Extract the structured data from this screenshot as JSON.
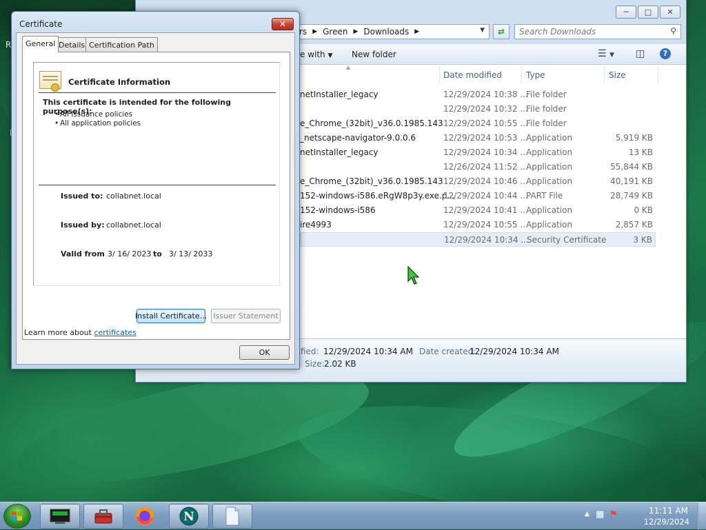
{
  "explorer": {
    "address": {
      "crumbs": [
        "rs",
        "Green",
        "Downloads"
      ]
    },
    "search_placeholder": "Search Downloads",
    "toolbar": {
      "open_with": "e with",
      "new_folder": "New folder"
    },
    "columns": {
      "date_modified": "Date modified",
      "type": "Type",
      "size": "Size"
    },
    "rows": [
      {
        "name": "netInstaller_legacy",
        "date": "12/29/2024 10:38 ...",
        "type": "File folder",
        "size": ""
      },
      {
        "name": "",
        "date": "12/29/2024 10:32 ...",
        "type": "File folder",
        "size": ""
      },
      {
        "name": "e_Chrome_(32bit)_v36.0.1985.143",
        "date": "12/29/2024 10:55 ...",
        "type": "File folder",
        "size": ""
      },
      {
        "name": "_netscape-navigator-9.0.0.6",
        "date": "12/29/2024 10:53 ...",
        "type": "Application",
        "size": "5,919 KB"
      },
      {
        "name": "netInstaller_legacy",
        "date": "12/29/2024 10:34 ...",
        "type": "Application",
        "size": "13 KB"
      },
      {
        "name": "",
        "date": "12/26/2024 11:52 ...",
        "type": "Application",
        "size": "55,844 KB"
      },
      {
        "name": "e_Chrome_(32bit)_v36.0.1985.143",
        "date": "12/29/2024 10:46 ...",
        "type": "Application",
        "size": "40,191 KB"
      },
      {
        "name": "152-windows-i586.eRgW8p3y.exe.p...",
        "date": "12/29/2024 10:44 ...",
        "type": "PART File",
        "size": "28,749 KB"
      },
      {
        "name": "152-windows-i586",
        "date": "12/29/2024 10:41 ...",
        "type": "Application",
        "size": "0 KB"
      },
      {
        "name": "ire4993",
        "date": "12/29/2024 10:55 ...",
        "type": "Application",
        "size": "2,857 KB"
      },
      {
        "name": "",
        "date": "12/29/2024 10:34 ...",
        "type": "Security Certificate",
        "size": "3 KB",
        "selected": true
      }
    ],
    "details": {
      "modified_label": "dified:",
      "modified_value": "12/29/2024 10:34 AM",
      "created_label": "Date created:",
      "created_value": "12/29/2024 10:34 AM",
      "size_label": "Size:",
      "size_value": "2.02 KB"
    }
  },
  "certificate": {
    "title": "Certificate",
    "close_label": "✕",
    "tabs": [
      "General",
      "Details",
      "Certification Path"
    ],
    "info_title": "Certificate Information",
    "purpose_heading": "This certificate is intended for the following purpose(s):",
    "purposes": [
      "All issuance policies",
      "All application policies"
    ],
    "issued_to_label": "Issued to:",
    "issued_to": "collabnet.local",
    "issued_by_label": "Issued by:",
    "issued_by": "collabnet.local",
    "valid_from_label": "Valid from",
    "valid_from": "3/ 16/ 2023",
    "valid_to_label": "to",
    "valid_to": "3/ 13/ 2033",
    "install_button": "Install Certificate...",
    "issuer_statement_button": "Issuer Statement",
    "learn_more_prefix": "Learn more about ",
    "learn_more_link": "certificates",
    "ok_button": "OK"
  },
  "taskbar": {
    "time": "11:11 AM",
    "date": "12/29/2024"
  },
  "desktop": {
    "edge_chars": [
      "R",
      "l"
    ]
  }
}
